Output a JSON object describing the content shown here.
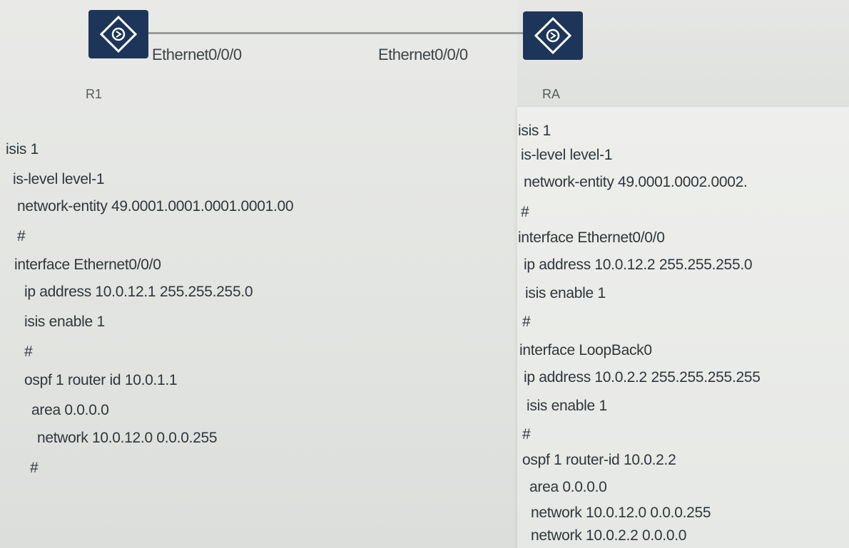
{
  "topology": {
    "r1_interface": "Ethernet0/0/0",
    "r2_interface": "Ethernet0/0/0",
    "r1_name": "R1",
    "r2_name": "RA",
    "router_icon": "router-icon"
  },
  "r1_config": [
    "isis 1",
    "is-level level-1",
    "network-entity 49.0001.0001.0001.0001.00",
    "#",
    "interface Ethernet0/0/0",
    "ip address 10.0.12.1 255.255.255.0",
    "isis enable 1",
    "#",
    "ospf 1 router id 10.0.1.1",
    "area 0.0.0.0",
    "network 10.0.12.0 0.0.0.255",
    "#"
  ],
  "r2_config": [
    "isis 1",
    "is-level level-1",
    "network-entity 49.0001.0002.0002.",
    "#",
    "interface Ethernet0/0/0",
    "ip address 10.0.12.2 255.255.255.0",
    "isis enable 1",
    "#",
    "interface LoopBack0",
    "ip address 10.0.2.2 255.255.255.255",
    "isis enable 1",
    "#",
    "ospf 1 router-id 10.0.2.2",
    "area 0.0.0.0",
    "network 10.0.12.0 0.0.0.255",
    "network 10.0.2.2 0.0.0.0"
  ]
}
